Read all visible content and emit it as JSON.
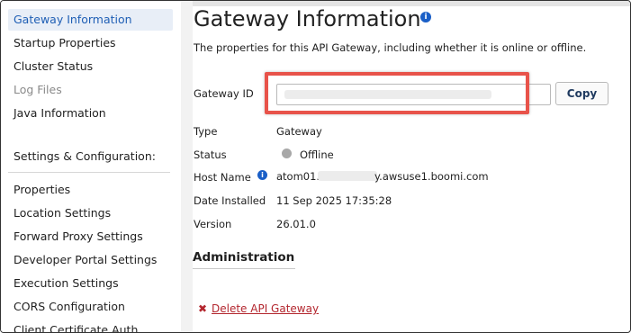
{
  "sidebar": {
    "items": [
      {
        "label": "Gateway Information",
        "state": "active"
      },
      {
        "label": "Startup Properties",
        "state": "normal"
      },
      {
        "label": "Cluster Status",
        "state": "normal"
      },
      {
        "label": "Log Files",
        "state": "disabled"
      },
      {
        "label": "Java Information",
        "state": "normal"
      }
    ],
    "section_heading": "Settings & Configuration:",
    "settings_items": [
      {
        "label": "Properties"
      },
      {
        "label": "Location Settings"
      },
      {
        "label": "Forward Proxy Settings"
      },
      {
        "label": "Developer Portal Settings"
      },
      {
        "label": "Execution Settings"
      },
      {
        "label": "CORS Configuration"
      },
      {
        "label": "Client Certificate Auth"
      }
    ]
  },
  "main": {
    "title": "Gateway Information",
    "info_icon": "info-icon",
    "description": "The properties for this API Gateway, including whether it is online or offline.",
    "gateway_id": {
      "label": "Gateway ID",
      "value": "",
      "copy_label": "Copy"
    },
    "fields": {
      "type_label": "Type",
      "type_value": "Gateway",
      "status_label": "Status",
      "status_value": "Offline",
      "host_label": "Host Name",
      "host_prefix": "atom01.a",
      "host_suffix": "y.awsuse1.boomi.com",
      "installed_label": "Date Installed",
      "installed_value": "11 Sep 2025 17:35:28",
      "version_label": "Version",
      "version_value": "26.01.0"
    },
    "administration": {
      "heading": "Administration",
      "delete_label": "Delete API Gateway"
    }
  },
  "colors": {
    "accent": "#1f5fb5",
    "active_bg": "#e8eef7",
    "highlight": "#e8534a",
    "danger": "#b3262e",
    "offline_dot": "#a8a8a8"
  }
}
